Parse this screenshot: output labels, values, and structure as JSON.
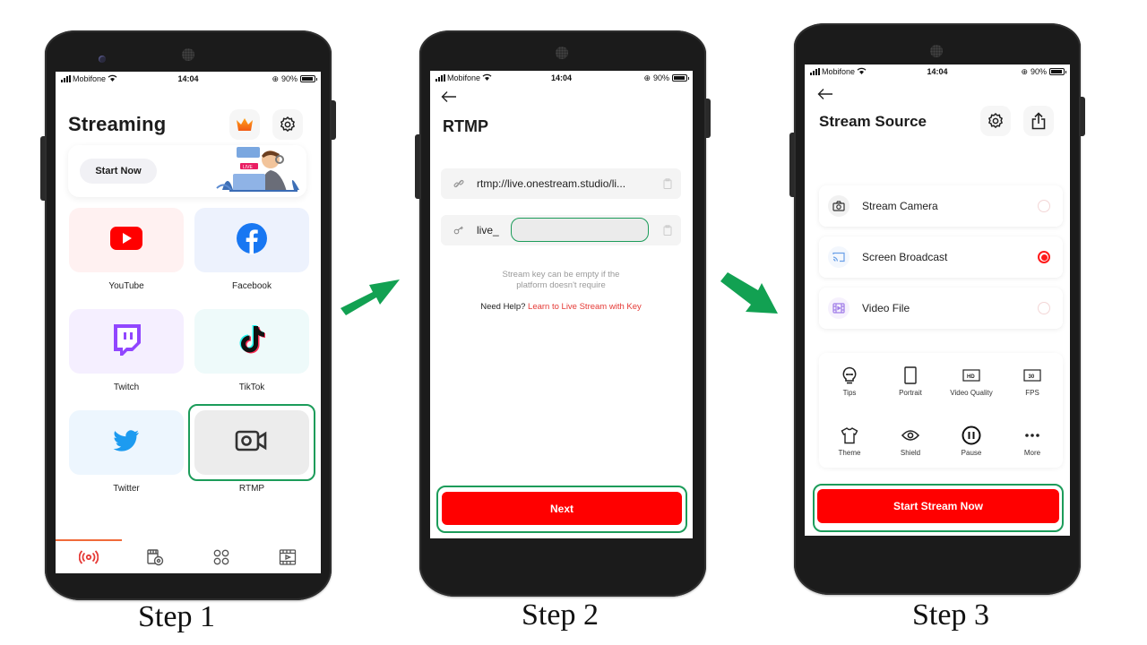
{
  "status_bar": {
    "carrier": "Mobifone",
    "time": "14:04",
    "battery": "90%"
  },
  "step1": {
    "label": "Step 1",
    "title": "Streaming",
    "banner": {
      "button": "Start Now",
      "illustration_badge": "LIVE"
    },
    "platforms": [
      {
        "label": "YouTube",
        "icon": "youtube-icon",
        "bg": "#fff1f1"
      },
      {
        "label": "Facebook",
        "icon": "facebook-icon",
        "bg": "#edf2fd"
      },
      {
        "label": "Twitch",
        "icon": "twitch-icon",
        "bg": "#f5efff"
      },
      {
        "label": "TikTok",
        "icon": "tiktok-icon",
        "bg": "#eefafa"
      },
      {
        "label": "Twitter",
        "icon": "twitter-icon",
        "bg": "#edf6fe"
      },
      {
        "label": "RTMP",
        "icon": "video-camera-icon",
        "bg": "#ececec",
        "highlighted": true
      }
    ],
    "tabs": [
      "live-broadcast-icon",
      "schedule-video-icon",
      "apps-grid-icon",
      "video-library-icon"
    ],
    "active_tab": 0
  },
  "step2": {
    "label": "Step 2",
    "title": "RTMP",
    "server_url": "rtmp://live.onestream.studio/li...",
    "stream_key": "live_",
    "hint": "Stream key can be empty if the platform doesn't require",
    "help_prefix": "Need Help?",
    "help_link": "Learn to Live Stream with Key",
    "next_button": "Next"
  },
  "step3": {
    "label": "Step 3",
    "title": "Stream Source",
    "sources": [
      {
        "label": "Stream Camera",
        "icon": "camera-icon",
        "selected": false
      },
      {
        "label": "Screen Broadcast",
        "icon": "cast-icon",
        "selected": true
      },
      {
        "label": "Video File",
        "icon": "video-file-icon",
        "selected": false
      }
    ],
    "tools": [
      {
        "label": "Tips",
        "icon": "lightbulb-icon"
      },
      {
        "label": "Portrait",
        "icon": "portrait-icon"
      },
      {
        "label": "Video Quality",
        "icon": "hd-icon",
        "badge": "HD"
      },
      {
        "label": "FPS",
        "icon": "fps-icon",
        "badge": "30"
      },
      {
        "label": "Theme",
        "icon": "shirt-icon"
      },
      {
        "label": "Shield",
        "icon": "eye-icon"
      },
      {
        "label": "Pause",
        "icon": "pause-icon"
      },
      {
        "label": "More",
        "icon": "more-icon"
      }
    ],
    "start_button": "Start Stream Now"
  },
  "colors": {
    "accent_red": "#ff0000",
    "highlight_green": "#1c9c5a",
    "arrow_green": "#12a152"
  }
}
